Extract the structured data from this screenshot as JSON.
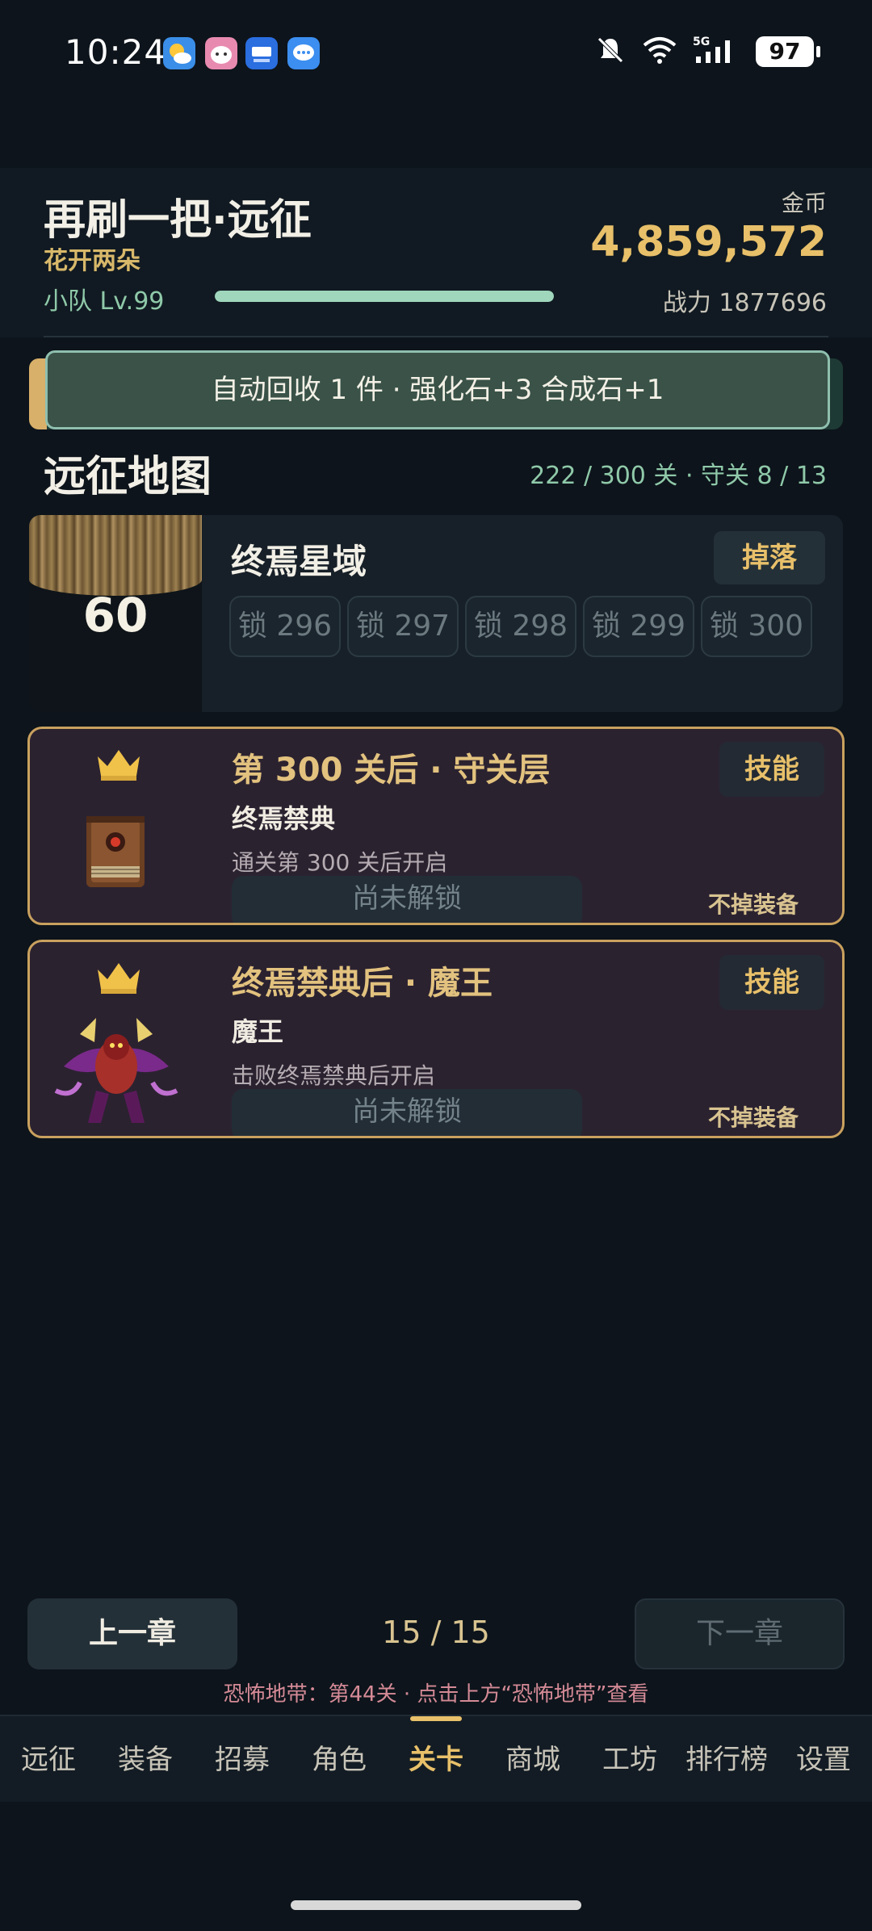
{
  "status_bar": {
    "time": "10:24",
    "battery": "97",
    "app_icons": [
      "weather-app-icon",
      "chat-mascot-app-icon",
      "service-app-icon",
      "message-app-icon"
    ],
    "icons": [
      "bell-muted-icon",
      "wifi-icon",
      "signal-5g-icon",
      "battery-icon"
    ]
  },
  "header": {
    "title": "再刷一把·远征",
    "player_name": "花开两朵",
    "team_level": "小队 Lv.99",
    "xp_progress": 1.0,
    "gold_label": "金币",
    "gold_value": "4,859,572",
    "power": "战力 1877696"
  },
  "banner": {
    "text": "自动回收 1 件 · 强化石+3 合成石+1"
  },
  "section": {
    "title": "远征地图",
    "progress": "222 / 300 关 · 守关 8 / 13"
  },
  "map_card": {
    "level_number": "60",
    "name": "终焉星域",
    "drop_label": "掉落",
    "locked_stages": [
      "锁 296",
      "锁 297",
      "锁 298",
      "锁 299",
      "锁 300"
    ]
  },
  "boss_cards": [
    {
      "title": "第 300 关后 · 守关层",
      "name": "终焉禁典",
      "requirement": "通关第 300 关后开启",
      "skill_label": "技能",
      "locked_label": "尚未解锁",
      "drop_note": "不掉装备",
      "art_icon": "tome-icon"
    },
    {
      "title": "终焉禁典后 · 魔王",
      "name": "魔王",
      "requirement": "击败终焉禁典后开启",
      "skill_label": "技能",
      "locked_label": "尚未解锁",
      "drop_note": "不掉装备",
      "art_icon": "demon-king-icon"
    }
  ],
  "chapter_nav": {
    "prev_label": "上一章",
    "next_label": "下一章",
    "page": "15 / 15",
    "hint": "恐怖地带：第44关 · 点击上方“恐怖地带”查看"
  },
  "bottom_nav": {
    "items": [
      "远征",
      "装备",
      "招募",
      "角色",
      "关卡",
      "商城",
      "工坊",
      "排行榜",
      "设置"
    ],
    "active": "关卡"
  },
  "colors": {
    "accent_gold": "#e8c06a",
    "accent_green": "#8fc9a9",
    "boss_border": "#c9a15e",
    "hint_pink": "#d48a96"
  }
}
